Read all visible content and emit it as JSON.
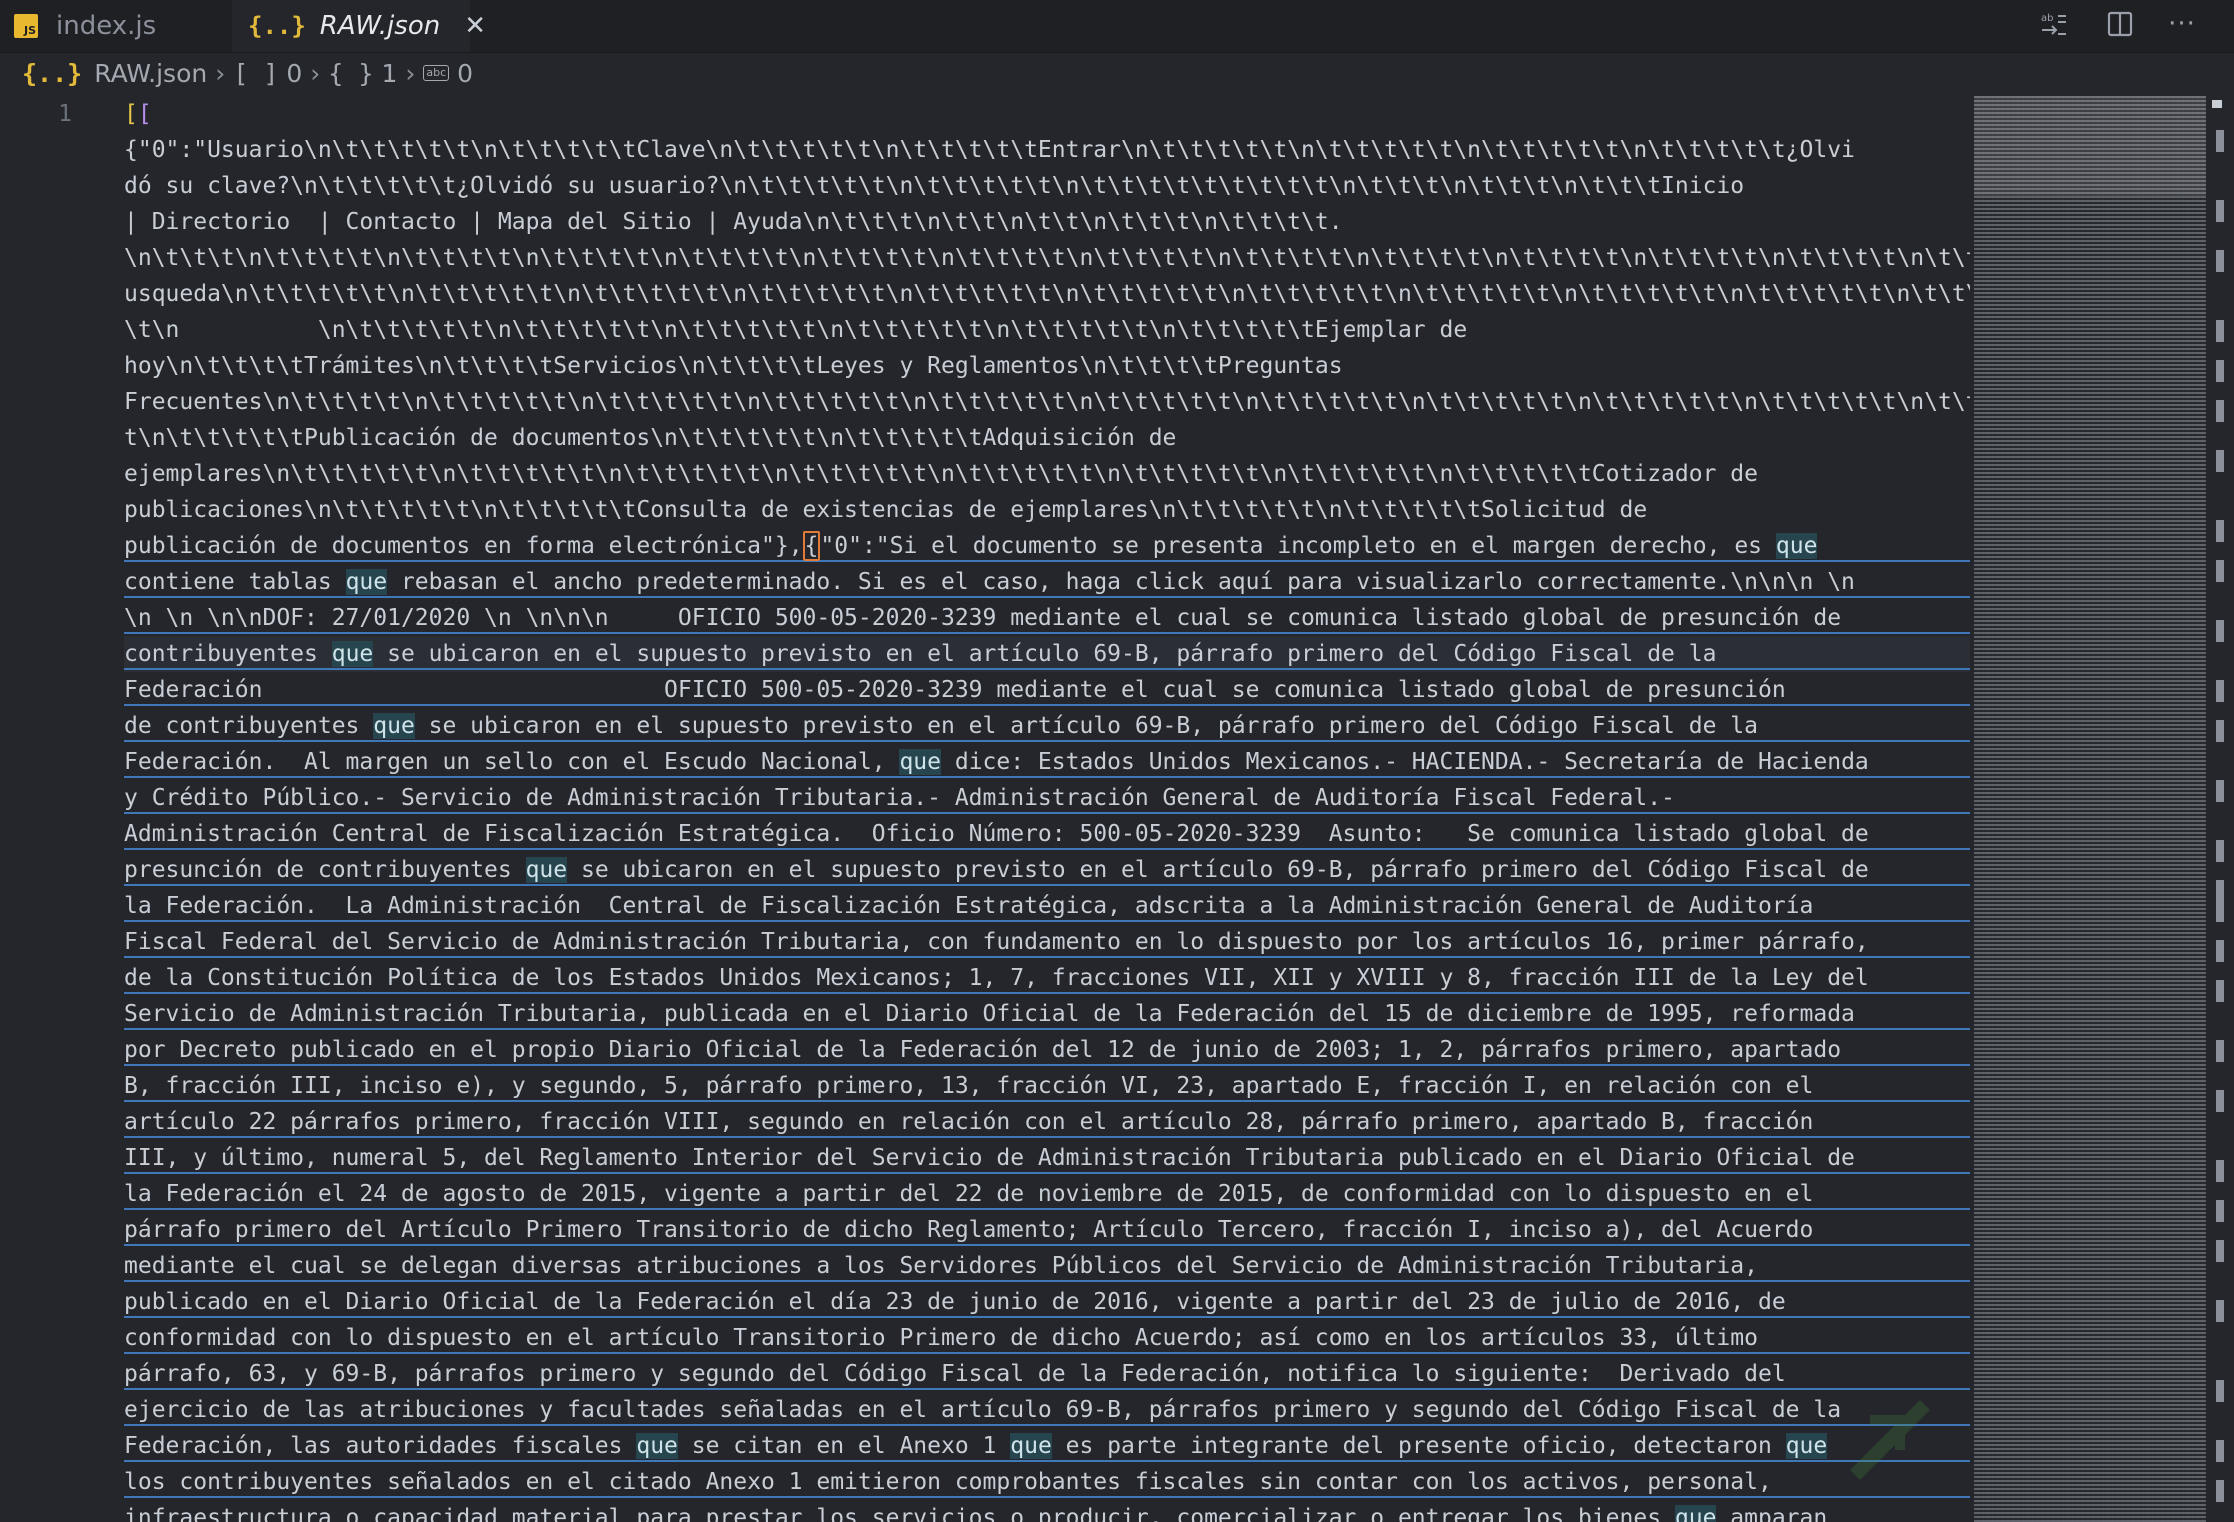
{
  "tabs": [
    {
      "label": "index.js",
      "icon": "js-file-icon",
      "active": false
    },
    {
      "label": "RAW.json",
      "icon": "json-file-icon",
      "active": true
    }
  ],
  "breadcrumbs": {
    "file": "RAW.json",
    "seg1_icon": "[ ]",
    "seg1_value": "0",
    "seg2_icon": "{ }",
    "seg2_value": "1",
    "seg3_icon": "abc",
    "seg3_value": "0"
  },
  "editor": {
    "line_number": "1",
    "lines": [
      "[[",
      "{\"0\":\"Usuario\\n\\t\\t\\t\\t\\t\\n\\t\\t\\t\\t\\tClave\\n\\t\\t\\t\\t\\t\\n\\t\\t\\t\\t\\tEntrar\\n\\t\\t\\t\\t\\t\\n\\t\\t\\t\\t\\t\\n\\t\\t\\t\\t\\t\\n\\t\\t\\t\\t\\t¿Olvi",
      "dó su clave?\\n\\t\\t\\t\\t\\t¿Olvidó su usuario?\\n\\t\\t\\t\\t\\t\\n\\t\\t\\t\\t\\t\\n\\t\\t\\t\\t\\t\\t\\t\\t\\t\\n\\t\\t\\t\\n\\t\\t\\t\\n\\t\\t\\tInicio",
      "| Directorio  | Contacto | Mapa del Sitio | Ayuda\\n\\t\\t\\t\\n\\t\\t\\n\\t\\t\\n\\t\\t\\t\\n\\t\\t\\t\\t.",
      "\\n\\t\\t\\t\\n\\t\\t\\t\\t\\n\\t\\t\\t\\t\\n\\t\\t\\t\\t\\n\\t\\t\\t\\t\\n\\t\\t\\t\\t\\n\\t\\t\\t\\t\\n\\t\\t\\t\\t\\n\\t\\t\\t\\t\\n\\t\\t\\t\\t\\n\\t\\t\\t\\t\\n\\t\\t\\t\\t\\n\\t\\t\\t\\t\\n\\t\\t\\t\\t\\tB",
      "usqueda\\n\\t\\t\\t\\t\\t\\n\\t\\t\\t\\t\\t\\n\\t\\t\\t\\t\\t\\n\\t\\t\\t\\t\\t\\n\\t\\t\\t\\t\\t\\n\\t\\t\\t\\t\\t\\n\\t\\t\\t\\t\\t\\n\\t\\t\\t\\t\\t\\n\\t\\t\\t\\t\\t\\n\\t\\t\\t\\t\\t\\n\\t\\t\\t\\t\\t\\n\\t",
      "\\t\\n          \\n\\t\\t\\t\\t\\t\\n\\t\\t\\t\\t\\t\\n\\t\\t\\t\\t\\t\\n\\t\\t\\t\\t\\t\\n\\t\\t\\t\\t\\t\\n\\t\\t\\t\\t\\tEjemplar de",
      "hoy\\n\\t\\t\\t\\tTrámites\\n\\t\\t\\t\\tServicios\\n\\t\\t\\t\\tLeyes y Reglamentos\\n\\t\\t\\t\\tPreguntas",
      "Frecuentes\\n\\t\\t\\t\\t\\n\\t\\t\\t\\t\\t\\n\\t\\t\\t\\t\\t\\n\\t\\t\\t\\t\\t\\n\\t\\t\\t\\t\\t\\n\\t\\t\\t\\t\\t\\n\\t\\t\\t\\t\\t\\n\\t\\t\\t\\t\\t\\n\\t\\t\\t\\t\\t\\n\\t\\t\\t\\t\\t\\n\\t\\t\\t\\t\\t\\t",
      "t\\n\\t\\t\\t\\t\\tPublicación de documentos\\n\\t\\t\\t\\t\\t\\n\\t\\t\\t\\t\\tAdquisición de",
      "ejemplares\\n\\t\\t\\t\\t\\t\\n\\t\\t\\t\\t\\t\\n\\t\\t\\t\\t\\t\\n\\t\\t\\t\\t\\t\\n\\t\\t\\t\\t\\t\\n\\t\\t\\t\\t\\t\\n\\t\\t\\t\\t\\t\\n\\t\\t\\t\\t\\tCotizador de",
      "publicaciones\\n\\t\\t\\t\\t\\t\\n\\t\\t\\t\\t\\tConsulta de existencias de ejemplares\\n\\t\\t\\t\\t\\t\\n\\t\\t\\t\\t\\tSolicitud de",
      "publicación de documentos en forma electrónica\"},{\"0\":\"Si el documento se presenta incompleto en el margen derecho, es que",
      "contiene tablas que rebasan el ancho predeterminado. Si es el caso, haga click aquí para visualizarlo correctamente.\\n\\n\\n \\n",
      "\\n \\n \\n\\nDOF: 27/01/2020 \\n \\n\\n\\n     OFICIO 500-05-2020-3239 mediante el cual se comunica listado global de presunción de",
      "contribuyentes que se ubicaron en el supuesto previsto en el artículo 69-B, párrafo primero del Código Fiscal de la",
      "Federación                             OFICIO 500-05-2020-3239 mediante el cual se comunica listado global de presunción",
      "de contribuyentes que se ubicaron en el supuesto previsto en el artículo 69-B, párrafo primero del Código Fiscal de la",
      "Federación.  Al margen un sello con el Escudo Nacional, que dice: Estados Unidos Mexicanos.- HACIENDA.- Secretaría de Hacienda",
      "y Crédito Público.- Servicio de Administración Tributaria.- Administración General de Auditoría Fiscal Federal.-",
      "Administración Central de Fiscalización Estratégica.  Oficio Número: 500-05-2020-3239  Asunto:   Se comunica listado global de",
      "presunción de contribuyentes que se ubicaron en el supuesto previsto en el artículo 69-B, párrafo primero del Código Fiscal de",
      "la Federación.  La Administración  Central de Fiscalización Estratégica, adscrita a la Administración General de Auditoría",
      "Fiscal Federal del Servicio de Administración Tributaria, con fundamento en lo dispuesto por los artículos 16, primer párrafo,",
      "de la Constitución Política de los Estados Unidos Mexicanos; 1, 7, fracciones VII, XII y XVIII y 8, fracción III de la Ley del",
      "Servicio de Administración Tributaria, publicada en el Diario Oficial de la Federación del 15 de diciembre de 1995, reformada",
      "por Decreto publicado en el propio Diario Oficial de la Federación del 12 de junio de 2003; 1, 2, párrafos primero, apartado",
      "B, fracción III, inciso e), y segundo, 5, párrafo primero, 13, fracción VI, 23, apartado E, fracción I, en relación con el",
      "artículo 22 párrafos primero, fracción VIII, segundo en relación con el artículo 28, párrafo primero, apartado B, fracción",
      "III, y último, numeral 5, del Reglamento Interior del Servicio de Administración Tributaria publicado en el Diario Oficial de",
      "la Federación el 24 de agosto de 2015, vigente a partir del 22 de noviembre de 2015, de conformidad con lo dispuesto en el",
      "párrafo primero del Artículo Primero Transitorio de dicho Reglamento; Artículo Tercero, fracción I, inciso a), del Acuerdo",
      "mediante el cual se delegan diversas atribuciones a los Servidores Públicos del Servicio de Administración Tributaria,",
      "publicado en el Diario Oficial de la Federación el día 23 de junio de 2016, vigente a partir del 23 de julio de 2016, de",
      "conformidad con lo dispuesto en el artículo Transitorio Primero de dicho Acuerdo; así como en los artículos 33, último",
      "párrafo, 63, y 69-B, párrafos primero y segundo del Código Fiscal de la Federación, notifica lo siguiente:  Derivado del",
      "ejercicio de las atribuciones y facultades señaladas en el artículo 69-B, párrafos primero y segundo del Código Fiscal de la",
      "Federación, las autoridades fiscales que se citan en el Anexo 1 que es parte integrante del presente oficio, detectaron que",
      "los contribuyentes señalados en el citado Anexo 1 emitieron comprobantes fiscales sin contar con los activos, personal,",
      "infraestructura o capacidad material para prestar los servicios o producir, comercializar o entregar los bienes que amparan"
    ]
  }
}
